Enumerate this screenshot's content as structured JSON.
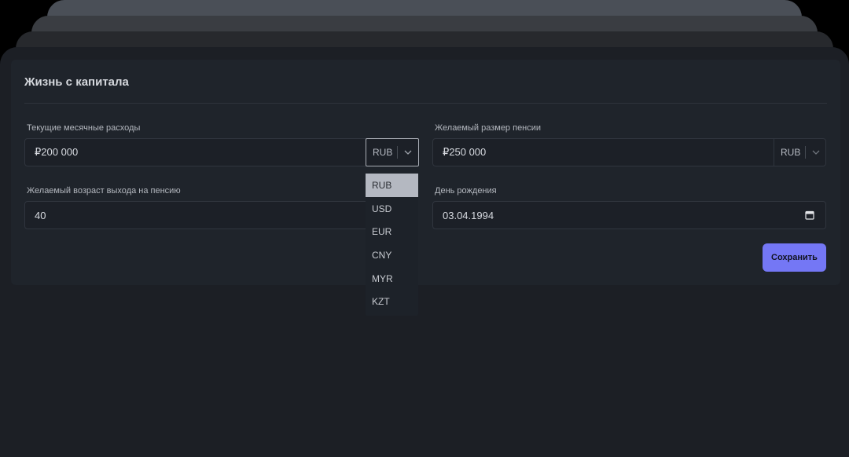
{
  "card": {
    "title": "Жизнь с капитала"
  },
  "fields": {
    "expenses": {
      "label": "Текущие месячные расходы",
      "value": "₽200 000",
      "currency": "RUB"
    },
    "pension": {
      "label": "Желаемый размер пенсии",
      "value": "₽250 000",
      "currency": "RUB"
    },
    "retirement_age": {
      "label": "Желаемый возраст выхода на пенсию",
      "value": "40"
    },
    "birthday": {
      "label": "День рождения",
      "value": "03.04.1994"
    }
  },
  "currency_dropdown": {
    "options": [
      "RUB",
      "USD",
      "EUR",
      "CNY",
      "MYR",
      "KZT"
    ],
    "selected": "RUB"
  },
  "actions": {
    "save_label": "Сохранить"
  },
  "colors": {
    "accent": "#7477f5",
    "background": "#1c1f25",
    "card": "#1f242b"
  },
  "icons": {
    "currency_toggle": "chevron-down-icon",
    "date_picker": "calendar-icon"
  }
}
